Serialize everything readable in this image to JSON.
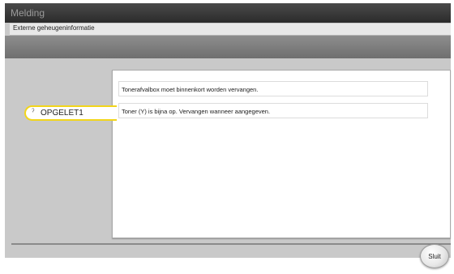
{
  "window": {
    "title": "Melding",
    "subtitle": "Externe geheugeninformatie"
  },
  "messages": [
    "Tonerafvalbox moet binnenkort worden vervangen.",
    "Toner (Y) is bijna op. Vervangen wanneer aangegeven."
  ],
  "tab": {
    "label": "OPGELET1",
    "icon": "warning-icon"
  },
  "footer": {
    "close_label": "Sluit"
  },
  "colors": {
    "accent": "#f2d51a",
    "titlebar": "#2b2b2b"
  }
}
